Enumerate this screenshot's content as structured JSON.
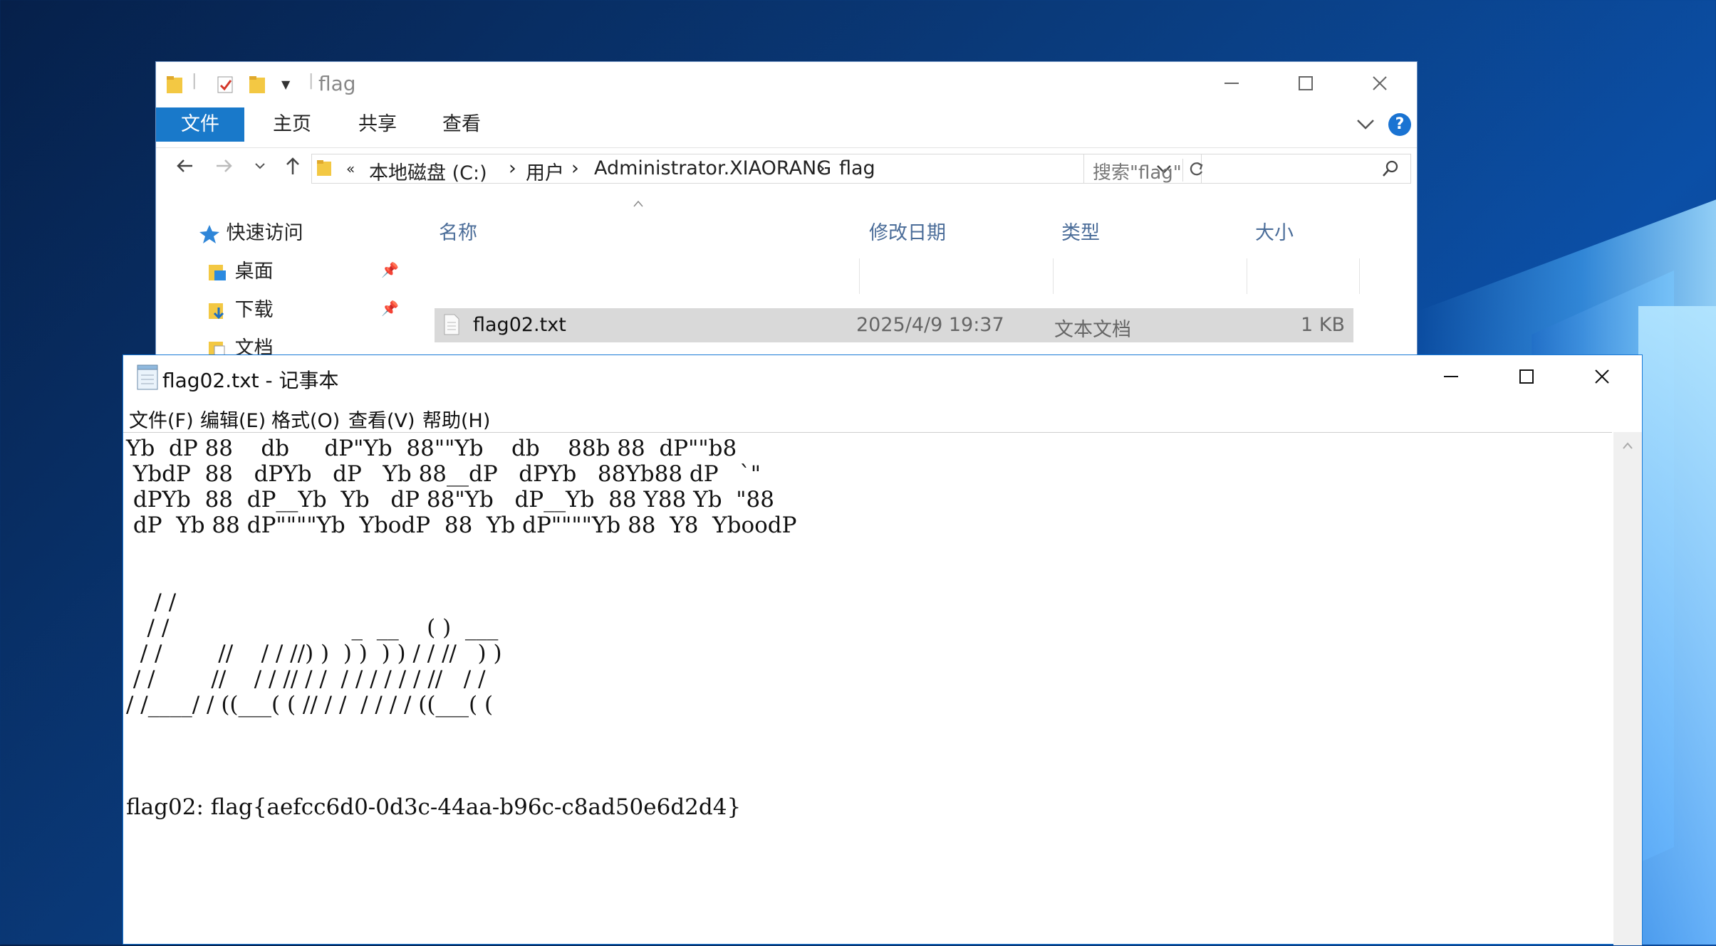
{
  "explorer": {
    "title": "flag",
    "tabs": {
      "file": "文件",
      "home": "主页",
      "share": "共享",
      "view": "查看"
    },
    "help_glyph": "?",
    "breadcrumb": {
      "overflow": "«",
      "drive": "本地磁盘 (C:)",
      "users": "用户",
      "user": "Administrator.XIAORANG",
      "folder": "flag",
      "sep": "›"
    },
    "search_placeholder": "搜索\"flag\"",
    "nav": {
      "quick_access": "快速访问",
      "desktop": "桌面",
      "downloads": "下载",
      "documents": "文档"
    },
    "columns": {
      "name": "名称",
      "modified": "修改日期",
      "type": "类型",
      "size": "大小"
    },
    "files": [
      {
        "name": "flag02.txt",
        "modified": "2025/4/9 19:37",
        "type": "文本文档",
        "size": "1 KB"
      }
    ]
  },
  "notepad": {
    "title": "flag02.txt - 记事本",
    "menu": {
      "file": "文件(F)",
      "edit": "编辑(E)",
      "format": "格式(O)",
      "view": "查看(V)",
      "help": "帮助(H)"
    },
    "content": "Yb  dP 88    db     dP\"Yb  88\"\"Yb    db    88b 88  dP\"\"b8\n YbdP  88   dPYb   dP   Yb 88__dP   dPYb   88Yb88 dP   `\"\n dPYb  88  dP__Yb  Yb   dP 88\"Yb   dP__Yb  88 Y88 Yb  \"88\n dP  Yb 88 dP\"\"\"\"Yb  YbodP  88  Yb dP\"\"\"\"Yb 88  Y8  YboodP\n\n\n    / /\n   / /                          _  __    ( )  ___\n  / /        //    / / //) )  ) )  ) ) / / //   ) )\n / /        //    / / // / /  / / / / / / //   / /\n/ /____/ / ((___( ( // / /  / / / / ((___( (\n\n\n\nflag02: flag{aefcc6d0-0d3c-44aa-b96c-c8ad50e6d2d4}"
  }
}
